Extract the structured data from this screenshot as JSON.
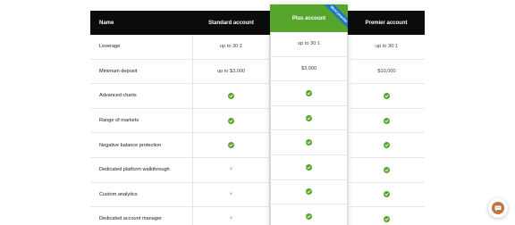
{
  "table": {
    "header_name": "Name",
    "plans": [
      "Standard account",
      "Plus account",
      "Premier account"
    ],
    "ribbon": "Most popular",
    "rows": [
      {
        "feature": "Leverage",
        "values": [
          "up to 30:1",
          "up to 30:1",
          "up to 30:1"
        ]
      },
      {
        "feature": "Minimum deposit",
        "values": [
          "up to $3,000",
          "$3,000",
          "$10,000"
        ]
      },
      {
        "feature": "Advanced charts",
        "values": [
          "check",
          "check",
          "check"
        ]
      },
      {
        "feature": "Range of markets",
        "values": [
          "check",
          "check",
          "check"
        ]
      },
      {
        "feature": "Negative balance protection",
        "values": [
          "check",
          "check",
          "check"
        ]
      },
      {
        "feature": "Dedicated platform walkthrough",
        "values": [
          "cross",
          "check",
          "check"
        ]
      },
      {
        "feature": "Custom analytics",
        "values": [
          "cross",
          "check",
          "check"
        ]
      },
      {
        "feature": "Dedicated account manager",
        "values": [
          "cross",
          "check",
          "check"
        ]
      }
    ]
  },
  "icons": {
    "check": "checkmark-icon",
    "cross": "cross-icon",
    "chat": "chat-bubble-icon"
  },
  "colors": {
    "header": "#0b0b0b",
    "plus": "#58a52b",
    "ribbon": "#1b77c9",
    "check": "#58a52b",
    "chat": "#c1753e"
  }
}
